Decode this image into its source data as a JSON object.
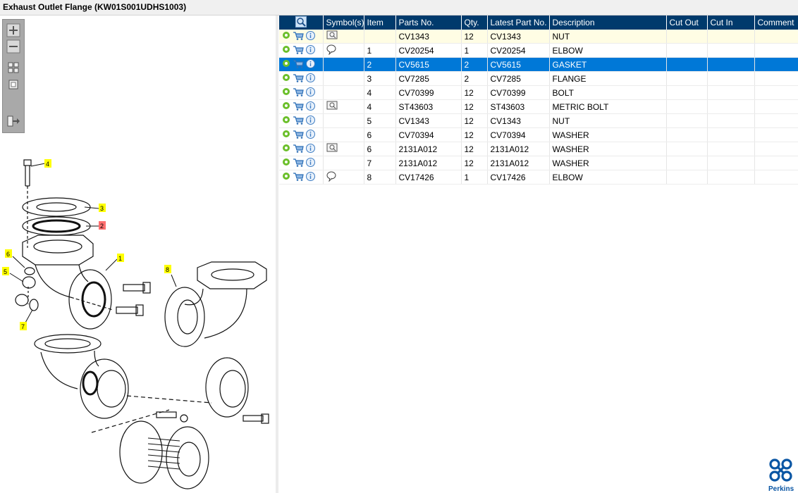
{
  "window": {
    "title": "Exhaust Outlet Flange (KW01S001UDHS1003)"
  },
  "viewer": {
    "toolbar": {
      "zoom_in_icon": "plus-icon",
      "zoom_out_icon": "minus-icon",
      "fit_icon": "grid-icon",
      "actual_size_icon": "square-icon",
      "export_icon": "export-icon"
    },
    "callouts": [
      "4",
      "3",
      "2",
      "1",
      "6",
      "5",
      "8",
      "7"
    ],
    "highlighted_callout": "2"
  },
  "grid": {
    "headers": [
      "",
      "Symbol(s)",
      "Item",
      "Parts No.",
      "Qty.",
      "Latest Part No.",
      "Description",
      "Cut Out",
      "Cut In",
      "Comment"
    ],
    "rows": [
      {
        "symbol": "book",
        "item": "",
        "part": "CV1343",
        "qty": "12",
        "latest": "CV1343",
        "desc": "NUT",
        "cut_out": "",
        "cut_in": "",
        "comment": ""
      },
      {
        "symbol": "bubble",
        "item": "1",
        "part": "CV20254",
        "qty": "1",
        "latest": "CV20254",
        "desc": "ELBOW",
        "cut_out": "",
        "cut_in": "",
        "comment": ""
      },
      {
        "symbol": "",
        "item": "2",
        "part": "CV5615",
        "qty": "2",
        "latest": "CV5615",
        "desc": "GASKET",
        "cut_out": "",
        "cut_in": "",
        "comment": ""
      },
      {
        "symbol": "",
        "item": "3",
        "part": "CV7285",
        "qty": "2",
        "latest": "CV7285",
        "desc": "FLANGE",
        "cut_out": "",
        "cut_in": "",
        "comment": ""
      },
      {
        "symbol": "",
        "item": "4",
        "part": "CV70399",
        "qty": "12",
        "latest": "CV70399",
        "desc": "BOLT",
        "cut_out": "",
        "cut_in": "",
        "comment": ""
      },
      {
        "symbol": "book",
        "item": "4",
        "part": "ST43603",
        "qty": "12",
        "latest": "ST43603",
        "desc": "METRIC BOLT",
        "cut_out": "",
        "cut_in": "",
        "comment": ""
      },
      {
        "symbol": "",
        "item": "5",
        "part": "CV1343",
        "qty": "12",
        "latest": "CV1343",
        "desc": "NUT",
        "cut_out": "",
        "cut_in": "",
        "comment": ""
      },
      {
        "symbol": "",
        "item": "6",
        "part": "CV70394",
        "qty": "12",
        "latest": "CV70394",
        "desc": "WASHER",
        "cut_out": "",
        "cut_in": "",
        "comment": ""
      },
      {
        "symbol": "book",
        "item": "6",
        "part": "2131A012",
        "qty": "12",
        "latest": "2131A012",
        "desc": "WASHER",
        "cut_out": "",
        "cut_in": "",
        "comment": ""
      },
      {
        "symbol": "",
        "item": "7",
        "part": "2131A012",
        "qty": "12",
        "latest": "2131A012",
        "desc": "WASHER",
        "cut_out": "",
        "cut_in": "",
        "comment": ""
      },
      {
        "symbol": "bubble",
        "item": "8",
        "part": "CV17426",
        "qty": "1",
        "latest": "CV17426",
        "desc": "ELBOW",
        "cut_out": "",
        "cut_in": "",
        "comment": ""
      }
    ],
    "highlighted_row": 0,
    "selected_row": 2
  },
  "brand": {
    "name": "Perkins",
    "color": "#0a56a4"
  },
  "colors": {
    "header_bg": "#003a6c",
    "selected_bg": "#0078d7",
    "highlight_bg": "#fffde4",
    "callout_yellow": "#ffff00",
    "callout_red": "#ff7070"
  }
}
